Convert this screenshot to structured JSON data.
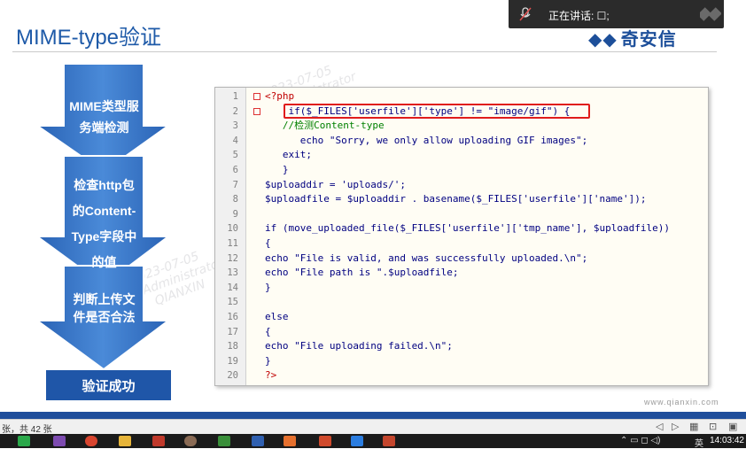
{
  "slide": {
    "title": "MIME-type验证",
    "logo_text": "奇安信"
  },
  "flow": {
    "step1": "MIME类型服务端检测",
    "step1_line1": "MIME类型服",
    "step1_line2": "务端检测",
    "step2_line1": "检查http包",
    "step2_line2": "的Content-",
    "step2_line3": "Type字段中",
    "step2_line4": "的值",
    "step3_line1": "判断上传文",
    "step3_line2": "件是否合法",
    "success": "验证成功",
    "colors": {
      "arrow": "#2f6fc2",
      "success_bg": "#1f56a8"
    }
  },
  "code": {
    "lines": [
      {
        "n": "1",
        "text": "<?php",
        "style": "red"
      },
      {
        "n": "2",
        "text": "    if($_FILES['userfile']['type'] != \"image/gif\") {",
        "style": "normal"
      },
      {
        "n": "3",
        "text": "   //检测Content-type",
        "style": "cmt"
      },
      {
        "n": "4",
        "text": "      echo \"Sorry, we only allow uploading GIF images\";",
        "style": "normal"
      },
      {
        "n": "5",
        "text": "   exit;",
        "style": "normal"
      },
      {
        "n": "6",
        "text": "   }",
        "style": "normal"
      },
      {
        "n": "7",
        "text": "$uploaddir = 'uploads/';",
        "style": "normal"
      },
      {
        "n": "8",
        "text": "$uploadfile = $uploaddir . basename($_FILES['userfile']['name']);",
        "style": "normal"
      },
      {
        "n": "9",
        "text": "",
        "style": "normal"
      },
      {
        "n": "10",
        "text": "if (move_uploaded_file($_FILES['userfile']['tmp_name'], $uploadfile))",
        "style": "normal"
      },
      {
        "n": "11",
        "text": "{",
        "style": "normal"
      },
      {
        "n": "12",
        "text": "echo \"File is valid, and was successfully uploaded.\\n\";",
        "style": "normal"
      },
      {
        "n": "13",
        "text": "echo \"File path is \".$uploadfile;",
        "style": "normal"
      },
      {
        "n": "14",
        "text": "}",
        "style": "normal"
      },
      {
        "n": "15",
        "text": "",
        "style": "normal"
      },
      {
        "n": "16",
        "text": "else",
        "style": "normal"
      },
      {
        "n": "17",
        "text": "{",
        "style": "normal"
      },
      {
        "n": "18",
        "text": "echo \"File uploading failed.\\n\";",
        "style": "normal"
      },
      {
        "n": "19",
        "text": "}",
        "style": "normal"
      },
      {
        "n": "20",
        "text": "?>",
        "style": "red"
      }
    ],
    "highlight_color": "#e01c1c"
  },
  "footer": {
    "url": "www.qianxin.com",
    "slide_count": "张，共 42 张",
    "clock": "14:03:42",
    "ime": "英"
  },
  "overlay": {
    "speaking_label": "正在讲话: ☐;"
  },
  "watermarks": {
    "date": "2023-07-05",
    "user": "Administrator",
    "org": "QIANXIN"
  }
}
